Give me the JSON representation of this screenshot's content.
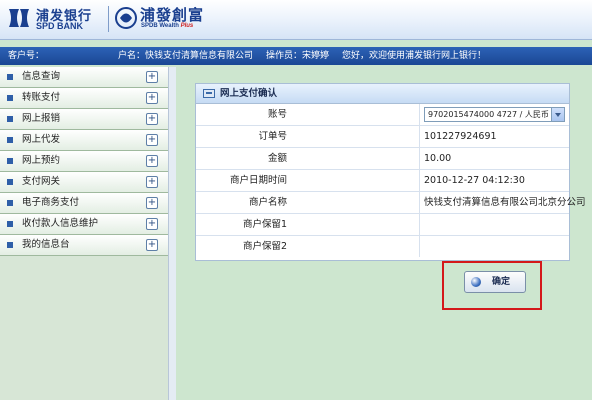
{
  "header": {
    "bank_name_cn": "浦发银行",
    "bank_name_en": "SPD BANK",
    "wealth_name_cn": "浦發創富",
    "wealth_name_en": "SPDB Wealth",
    "wealth_name_plus": "Plus"
  },
  "infobar": {
    "customer_no_label": "客户号：",
    "account_name": "户名：快钱支付清算信息有限公司",
    "operator": "操作员：宋婷婷",
    "welcome": "您好，欢迎使用浦发银行网上银行！"
  },
  "sidebar": {
    "items": [
      {
        "label": "信息查询"
      },
      {
        "label": "转账支付"
      },
      {
        "label": "网上报销"
      },
      {
        "label": "网上代发"
      },
      {
        "label": "网上预约"
      },
      {
        "label": "支付网关"
      },
      {
        "label": "电子商务支付"
      },
      {
        "label": "收付款人信息维护"
      },
      {
        "label": "我的信息台"
      }
    ],
    "expand_glyph": "+"
  },
  "panel": {
    "title": "网上支付确认",
    "rows": [
      {
        "label": "账号",
        "value": "9702015474000 4727 / 人民币"
      },
      {
        "label": "订单号",
        "value": "101227924691"
      },
      {
        "label": "金额",
        "value": "10.00"
      },
      {
        "label": "商户日期时间",
        "value": "2010-12-27 04:12:30"
      },
      {
        "label": "商户名称",
        "value": "快钱支付清算信息有限公司北京分公司"
      },
      {
        "label": "商户保留1",
        "value": ""
      },
      {
        "label": "商户保留2",
        "value": ""
      }
    ]
  },
  "confirm_button": {
    "label": "确定"
  },
  "colors": {
    "brand_blue": "#1a3f8f",
    "infobar_blue": "#1a4794",
    "highlight_red": "#d4181a",
    "background_green": "#cde6cf"
  }
}
